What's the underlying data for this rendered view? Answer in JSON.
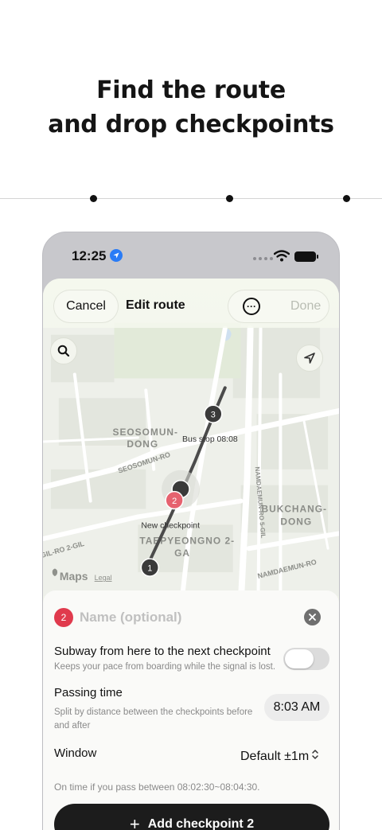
{
  "headline": {
    "line1": "Find the route",
    "line2": "and drop checkpoints"
  },
  "status_bar": {
    "time": "12:25"
  },
  "nav": {
    "cancel": "Cancel",
    "title": "Edit route",
    "more_icon": "ellipsis-icon",
    "done": "Done"
  },
  "map": {
    "labels": {
      "district1": "SEOSOMUN-",
      "district1b": "DONG",
      "road1": "SEOSOMUN-RO",
      "road2": "NAMDAEMUN-RO 5-GIL",
      "district2": "BUKCHANG-",
      "district2b": "DONG",
      "road3": "NAMDAEMUN-RO",
      "road4": "GIL-RO 2-GIL",
      "district3": "TAEPYEONGNO 2-",
      "district3b": "GA",
      "attribution": "Maps",
      "legal": "Legal"
    },
    "markers": [
      {
        "number": "3",
        "label": "Bus stop 08:08"
      },
      {
        "number": "2",
        "label": "New checkpoint"
      },
      {
        "number": "1"
      }
    ]
  },
  "checkpoint": {
    "number": "2",
    "name_value": "",
    "name_placeholder": "Name (optional)",
    "subway": {
      "title": "Subway from here to the next checkpoint",
      "subtitle": "Keeps your pace from boarding while the signal is lost.",
      "enabled": false
    },
    "passing_time": {
      "title": "Passing time",
      "subtitle_line1": "Split by distance between the checkpoints before",
      "subtitle_line2": "and after",
      "value": "8:03 AM"
    },
    "window": {
      "title": "Window",
      "value": "Default ±1m"
    },
    "note": "On time if you pass between 08:02:30~08:04:30.",
    "add_button": "Add checkpoint 2"
  },
  "colors": {
    "accent_red": "#e03a4d",
    "marker_dark": "#3a3a3a",
    "button_dark": "#1c1c1c",
    "location_blue": "#2a7cf6"
  }
}
